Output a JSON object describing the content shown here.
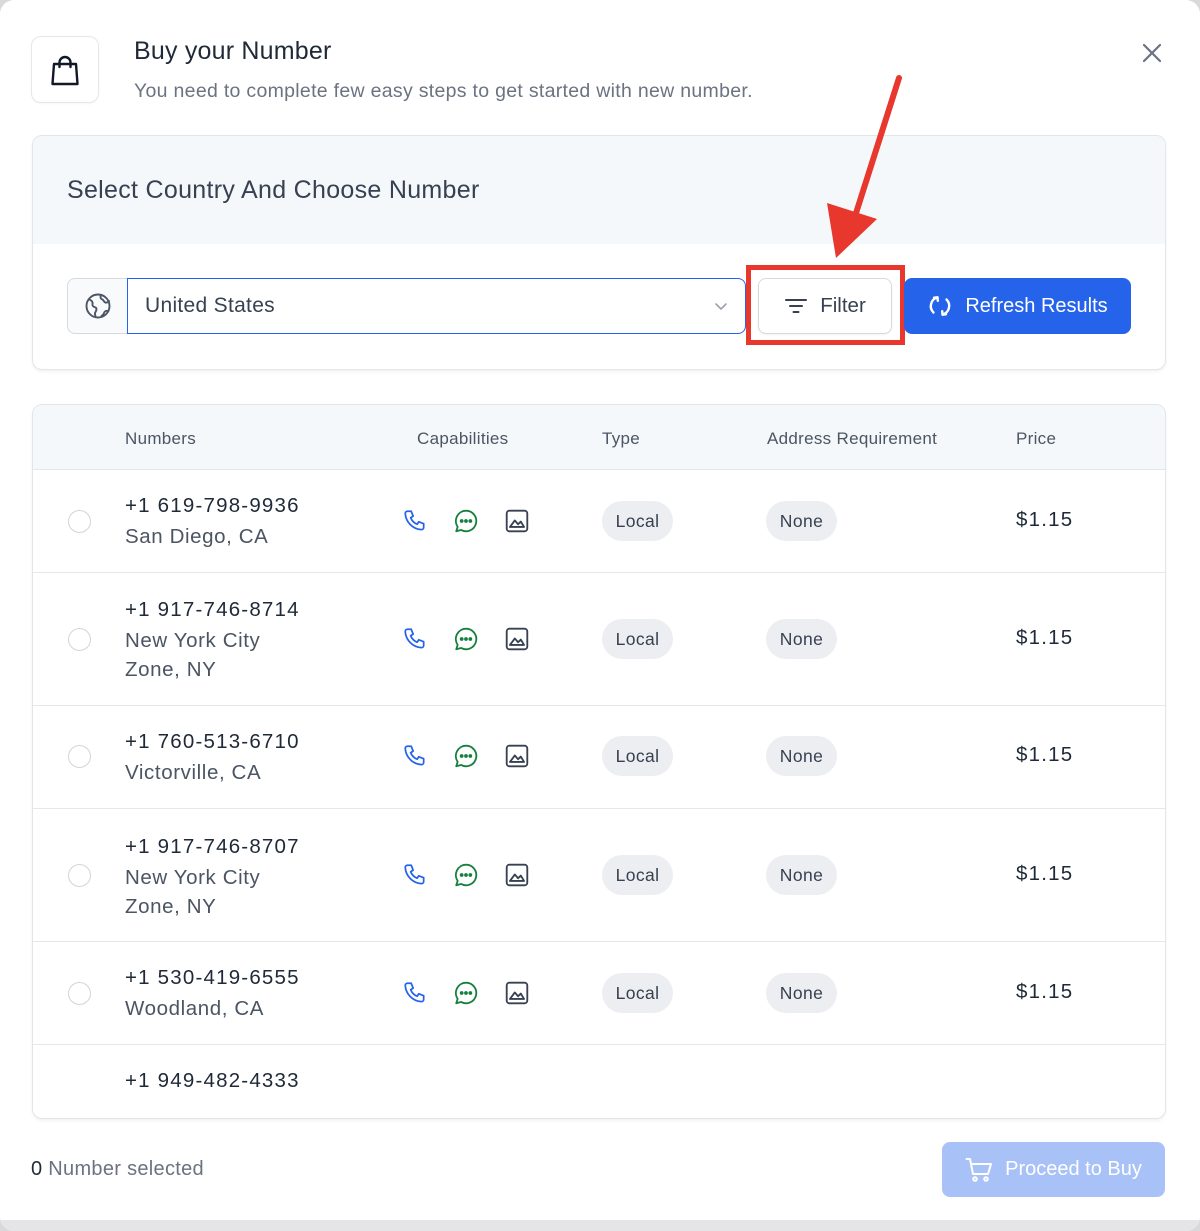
{
  "header": {
    "title": "Buy your Number",
    "subtitle": "You need to complete few easy steps to get started with new number."
  },
  "selection": {
    "section_title": "Select Country And Choose Number",
    "country": "United States",
    "filter_label": "Filter",
    "refresh_label": "Refresh Results"
  },
  "table": {
    "headers": {
      "numbers": "Numbers",
      "capabilities": "Capabilities",
      "type": "Type",
      "address": "Address Requirement",
      "price": "Price"
    },
    "rows": [
      {
        "number": "+1 619-798-9936",
        "location": "San Diego, CA",
        "type": "Local",
        "address": "None",
        "price": "$1.15"
      },
      {
        "number": "+1 917-746-8714",
        "location": "New York City Zone, NY",
        "type": "Local",
        "address": "None",
        "price": "$1.15"
      },
      {
        "number": "+1 760-513-6710",
        "location": "Victorville, CA",
        "type": "Local",
        "address": "None",
        "price": "$1.15"
      },
      {
        "number": "+1 917-746-8707",
        "location": "New York City Zone, NY",
        "type": "Local",
        "address": "None",
        "price": "$1.15"
      },
      {
        "number": "+1 530-419-6555",
        "location": "Woodland, CA",
        "type": "Local",
        "address": "None",
        "price": "$1.15"
      },
      {
        "number": "+1 949-482-4333"
      }
    ]
  },
  "footer": {
    "selected_count": "0",
    "selected_label": " Number selected",
    "proceed_label": "Proceed to Buy"
  },
  "icons": [
    "shopping-bag-icon",
    "close-icon",
    "globe-icon",
    "chevron-down-icon",
    "filter-icon",
    "refresh-icon",
    "phone-icon",
    "chat-icon",
    "image-icon",
    "cart-icon",
    "arrow-annotation"
  ],
  "colors": {
    "primary": "#2563eb",
    "primary_disabled": "#a8c1f6",
    "annotation": "#e8372c",
    "sms_green": "#15803d"
  }
}
